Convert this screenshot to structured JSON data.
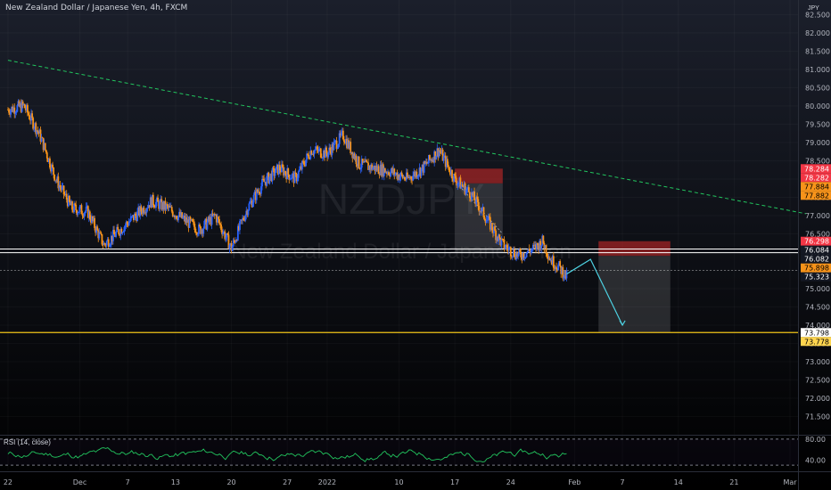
{
  "header": {
    "symbol_line": "New Zealand Dollar / Japanese Yen, 4h, FXCM",
    "currency": "JPY"
  },
  "watermark": {
    "ticker": "NZDJPY",
    "name": "New Zealand Dollar / Japanese Yen"
  },
  "rsi": {
    "title": "RSI (14, close)",
    "upper": 80.0,
    "lower": 30.0,
    "y_ticks": [
      "80.00",
      "40.00"
    ],
    "color": "#22c55e"
  },
  "price_labels": [
    {
      "text": "78.284",
      "value": 78.284,
      "bg": "#f23645",
      "fg": "#ffffff"
    },
    {
      "text": "78.282",
      "value": 78.282,
      "bg": "#f23645",
      "fg": "#ffffff"
    },
    {
      "text": "77.884",
      "value": 77.884,
      "bg": "#f7931a",
      "fg": "#000000"
    },
    {
      "text": "77.882",
      "value": 77.882,
      "bg": "#f7931a",
      "fg": "#000000"
    },
    {
      "text": "76.298",
      "value": 76.298,
      "bg": "#f23645",
      "fg": "#ffffff"
    },
    {
      "text": "76.084",
      "value": 76.084,
      "bg": "#131722",
      "fg": "#ffffff"
    },
    {
      "text": "76.082",
      "value": 76.082,
      "bg": "#131722",
      "fg": "#ffffff"
    },
    {
      "text": "75.898",
      "value": 75.898,
      "bg": "#f7931a",
      "fg": "#000000"
    },
    {
      "text": "75.323",
      "value": 75.323,
      "bg": "#131722",
      "fg": "#ffffff"
    },
    {
      "text": "73.798",
      "value": 73.798,
      "bg": "#ffffff",
      "fg": "#000000"
    },
    {
      "text": "73.778",
      "value": 73.778,
      "bg": "#ffd54f",
      "fg": "#000000"
    }
  ],
  "colors": {
    "background": "#131722",
    "up": "#2962ff",
    "down": "#f7931a",
    "trendline": "#22c55e",
    "support": "#ffffff",
    "target": "#f0c419",
    "projection": "#4dd0e1"
  },
  "chart_data": {
    "type": "candlestick",
    "timeframe": "4h",
    "ylim": [
      71.0,
      82.9
    ],
    "y_ticks": [
      "82.500",
      "82.000",
      "81.500",
      "81.000",
      "80.500",
      "80.000",
      "79.500",
      "79.000",
      "78.500",
      "78.000",
      "77.500",
      "77.000",
      "76.500",
      "76.000",
      "75.500",
      "75.000",
      "74.500",
      "74.000",
      "73.500",
      "73.000",
      "72.500",
      "72.000",
      "71.500"
    ],
    "y_tick_values": [
      82.5,
      82.0,
      81.5,
      81.0,
      80.5,
      80.0,
      79.5,
      79.0,
      78.5,
      78.0,
      77.5,
      77.0,
      76.5,
      76.0,
      75.5,
      75.0,
      74.5,
      74.0,
      73.5,
      73.0,
      72.5,
      72.0,
      71.5
    ],
    "x_ticks": [
      "22",
      "Dec",
      "7",
      "13",
      "20",
      "27",
      "2022",
      "10",
      "17",
      "24",
      "Feb",
      "7",
      "14",
      "21",
      "Mar"
    ],
    "x_tick_days": [
      0,
      9,
      15,
      21,
      28,
      35,
      40,
      49,
      56,
      63,
      71,
      77,
      84,
      91,
      98
    ],
    "close_path": [
      {
        "day": 0,
        "close": 79.9
      },
      {
        "day": 2,
        "close": 80.0
      },
      {
        "day": 4,
        "close": 79.2
      },
      {
        "day": 6,
        "close": 78.0
      },
      {
        "day": 8,
        "close": 77.2
      },
      {
        "day": 10,
        "close": 77.1
      },
      {
        "day": 12,
        "close": 76.2
      },
      {
        "day": 14,
        "close": 76.6
      },
      {
        "day": 16,
        "close": 77.0
      },
      {
        "day": 18,
        "close": 77.4
      },
      {
        "day": 20,
        "close": 77.2
      },
      {
        "day": 22,
        "close": 76.9
      },
      {
        "day": 24,
        "close": 76.6
      },
      {
        "day": 26,
        "close": 77.0
      },
      {
        "day": 28,
        "close": 76.1
      },
      {
        "day": 30,
        "close": 77.2
      },
      {
        "day": 32,
        "close": 77.9
      },
      {
        "day": 34,
        "close": 78.3
      },
      {
        "day": 36,
        "close": 78.0
      },
      {
        "day": 38,
        "close": 78.8
      },
      {
        "day": 40,
        "close": 78.7
      },
      {
        "day": 42,
        "close": 79.2
      },
      {
        "day": 44,
        "close": 78.4
      },
      {
        "day": 46,
        "close": 78.3
      },
      {
        "day": 48,
        "close": 78.2
      },
      {
        "day": 50,
        "close": 78.0
      },
      {
        "day": 52,
        "close": 78.3
      },
      {
        "day": 54,
        "close": 78.8
      },
      {
        "day": 56,
        "close": 78.0
      },
      {
        "day": 58,
        "close": 77.6
      },
      {
        "day": 60,
        "close": 76.9
      },
      {
        "day": 62,
        "close": 76.2
      },
      {
        "day": 64,
        "close": 75.9
      },
      {
        "day": 66,
        "close": 76.1
      },
      {
        "day": 67,
        "close": 76.3
      },
      {
        "day": 68,
        "close": 75.8
      },
      {
        "day": 69,
        "close": 75.6
      },
      {
        "day": 70,
        "close": 75.323
      }
    ],
    "trendline": {
      "start": {
        "day": 0,
        "price": 81.25
      },
      "end": {
        "day": 100,
        "price": 77.05
      }
    },
    "support_levels": [
      76.084,
      76.082
    ],
    "target_level": 73.798,
    "sell_zone_1": {
      "day_from": 56,
      "day_to": 62,
      "top": 78.284,
      "bottom": 77.882,
      "range_top": 77.882,
      "range_bottom": 76.0
    },
    "sell_zone_2": {
      "day_from": 74,
      "day_to": 83,
      "top": 76.298,
      "bottom": 75.898,
      "range_top": 75.898,
      "range_bottom": 73.798
    },
    "projection": [
      {
        "day": 70,
        "price": 75.4
      },
      {
        "day": 73,
        "price": 75.8
      },
      {
        "day": 77,
        "price": 74.0
      }
    ],
    "rsi_ylim": [
      20,
      85
    ]
  }
}
